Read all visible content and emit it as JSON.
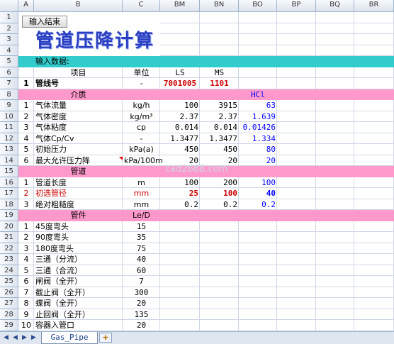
{
  "button_label": "输入结束",
  "title": "管道压降计算",
  "watermark": "cad2688.com",
  "columns": [
    "A",
    "B",
    "C",
    "BM",
    "BN",
    "BO",
    "BP",
    "BQ",
    "BR"
  ],
  "rows": [
    "1",
    "2",
    "3",
    "4",
    "5",
    "6",
    "7",
    "8",
    "9",
    "10",
    "11",
    "12",
    "13",
    "14",
    "15",
    "16",
    "17",
    "18",
    "19",
    "20",
    "21",
    "22",
    "23",
    "24",
    "25",
    "26",
    "27",
    "28",
    "29"
  ],
  "colors": {
    "teal": "#33cccc",
    "pink": "#ff99cc",
    "red": "#cc0000",
    "blue": "#0000ff",
    "darkred": "#cc0000",
    "title": "#2a3fbf"
  },
  "cells": {
    "r5_label": "输入数据:",
    "r6_item": "项目",
    "r6_unit": "单位",
    "r6_bm": "LS",
    "r6_bn": "MS",
    "r7_no": "1",
    "r7_item": "管线号",
    "r7_unit": "-",
    "r7_bm": "7001005",
    "r7_bn": "1101",
    "r8_section": "介质",
    "r8_bo": "HCl",
    "r9": [
      "1",
      "气体流量",
      "kg/h",
      "100",
      "3915",
      "63"
    ],
    "r10": [
      "2",
      "气体密度",
      "kg/m³",
      "2.37",
      "2.37",
      "1.639"
    ],
    "r11": [
      "3",
      "气体粘度",
      "cp",
      "0.014",
      "0.014",
      "0.01426"
    ],
    "r12": [
      "4",
      "气体Cp/Cv",
      "-",
      "1.3477",
      "1.3477",
      "1.334"
    ],
    "r13": [
      "5",
      "初始压力",
      "kPa(a)",
      "450",
      "450",
      "80"
    ],
    "r14": [
      "6",
      "最大允许压力降",
      "kPa/100m",
      "20",
      "20",
      "20"
    ],
    "r15_section": "管道",
    "r16": [
      "1",
      "管道长度",
      "m",
      "100",
      "200",
      "100"
    ],
    "r17": [
      "2",
      "初选管径",
      "mm",
      "25",
      "100",
      "40"
    ],
    "r18": [
      "3",
      "绝对粗糙度",
      "mm",
      "0.2",
      "0.2",
      "0.2"
    ],
    "r19_section": "管件",
    "r19_unit": "Le/D",
    "fittings": [
      [
        "1",
        "45度弯头",
        "15"
      ],
      [
        "2",
        "90度弯头",
        "35"
      ],
      [
        "3",
        "180度弯头",
        "75"
      ],
      [
        "4",
        "三通（分流）",
        "40"
      ],
      [
        "5",
        "三通（合流）",
        "60"
      ],
      [
        "6",
        "闸阀（全开）",
        "7"
      ],
      [
        "7",
        "截止阀（全开）",
        "300"
      ],
      [
        "8",
        "蝶阀（全开）",
        "20"
      ],
      [
        "9",
        "止回阀（全开）",
        "135"
      ],
      [
        "10",
        "容器入管口",
        "20"
      ]
    ]
  },
  "sheet_tab": "Gas_Pipe",
  "nav_icons": [
    "first-sheet-icon",
    "prev-sheet-icon",
    "next-sheet-icon",
    "last-sheet-icon"
  ]
}
